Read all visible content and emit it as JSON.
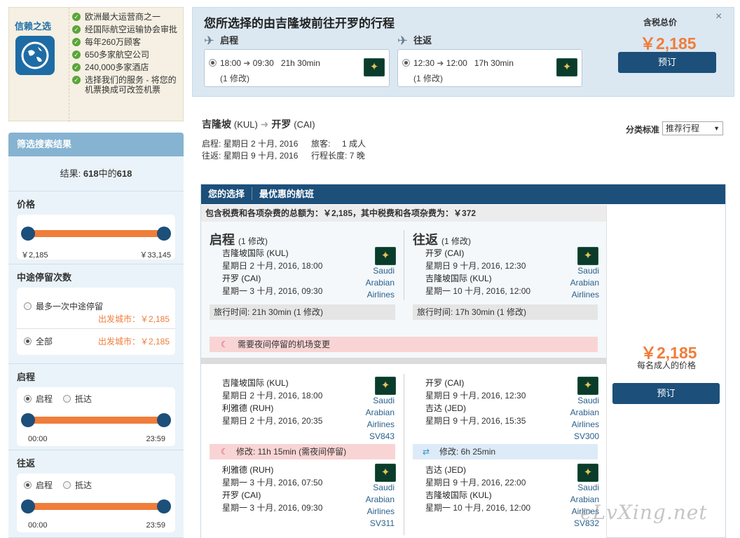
{
  "trust": {
    "title": "信赖之选",
    "items": [
      "欧洲最大运营商之一",
      "经国际航空运输协会审批",
      "每年260万顾客",
      "650多家航空公司",
      "240,000多家酒店",
      "选择我们的服务 - 将您的机票换成可改签机票"
    ]
  },
  "filter": {
    "header": "筛选搜索结果",
    "results_prefix": "结果: ",
    "results_count": "618",
    "results_mid": "中的",
    "results_total": "618",
    "price_title": "价格",
    "price_min": "￥2,185",
    "price_max": "￥33,145",
    "stops_title": "中途停留次数",
    "stop_opt1": "最多一次中途停留",
    "stop_opt1_price": "出发城市：￥2,185",
    "stop_opt2": "全部",
    "stop_opt2_price": "出发城市：￥2,185",
    "outbound_title": "启程",
    "return_title": "往返",
    "depart_label": "启程",
    "arrive_label": "抵达",
    "time_min": "00:00",
    "time_max": "23:59"
  },
  "selected": {
    "title": "您所选择的由吉隆坡前往开罗的行程",
    "out_label": "启程",
    "ret_label": "往返",
    "out_dep": "18:00",
    "out_arr": "09:30",
    "out_dur": "21h 30min",
    "out_stops": "(1 修改)",
    "ret_dep": "12:30",
    "ret_arr": "12:00",
    "ret_dur": "17h 30min",
    "ret_stops": "(1 修改)",
    "price_label": "含税总价",
    "price": "￥2,185",
    "book": "预订",
    "close": "×"
  },
  "route": {
    "from": "吉隆坡",
    "from_code": "(KUL)",
    "to": "开罗",
    "to_code": "(CAI)",
    "out_label": "启程:",
    "out_date": "星期日 2 十月, 2016",
    "ret_label": "往返:",
    "ret_date": "星期日 9 十月, 2016",
    "pax_label": "旅客:",
    "pax": "1 成人",
    "len_label": "行程长度:",
    "len": "7 晚",
    "sort_label": "分类标准",
    "sort_value": "推荐行程"
  },
  "card": {
    "tab1": "您的选择",
    "tab2": "最优惠的航班",
    "tax_note": "包含税费和各项杂费的总额为：￥2,185，其中税费和各项杂费为：￥372",
    "out_name": "启程",
    "out_sub": "(1 修改)",
    "ret_name": "往返",
    "ret_sub": "(1 修改)",
    "out_from": "吉隆坡国际 (KUL)",
    "out_from_time": "星期日 2 十月, 2016, 18:00",
    "out_to": "开罗 (CAI)",
    "out_to_time": "星期一 3 十月, 2016, 09:30",
    "ret_from": "开罗 (CAI)",
    "ret_from_time": "星期日 9 十月, 2016, 12:30",
    "ret_to": "吉隆坡国际 (KUL)",
    "ret_to_time": "星期一 10 十月, 2016, 12:00",
    "airline": [
      "Saudi",
      "Arabian",
      "Airlines"
    ],
    "out_travel": "旅行时间: 21h 30min (1 修改)",
    "ret_travel": "旅行时间: 17h 30min (1 修改)",
    "overnight_warn": "需要夜间停留的机场变更",
    "price": "￥2,185",
    "per_adult": "每名成人的价格",
    "book": "预订",
    "s1_from": "吉隆坡国际 (KUL)",
    "s1_from_time": "星期日 2 十月, 2016, 18:00",
    "s1_to": "利雅德 (RUH)",
    "s1_to_time": "星期日 2 十月, 2016, 20:35",
    "s1_flight": "SV843",
    "s1_layover": "修改: 11h 15min (需夜间停留)",
    "s2_from": "利雅德 (RUH)",
    "s2_from_time": "星期一 3 十月, 2016, 07:50",
    "s2_to": "开罗 (CAI)",
    "s2_to_time": "星期一 3 十月, 2016, 09:30",
    "s2_flight": "SV311",
    "r1_from": "开罗 (CAI)",
    "r1_from_time": "星期日 9 十月, 2016, 12:30",
    "r1_to": "吉达 (JED)",
    "r1_to_time": "星期日 9 十月, 2016, 15:35",
    "r1_flight": "SV300",
    "r1_layover": "修改: 6h 25min",
    "r2_from": "吉达 (JED)",
    "r2_from_time": "星期日 9 十月, 2016, 22:00",
    "r2_to": "吉隆坡国际 (KUL)",
    "r2_to_time": "星期一 10 十月, 2016, 12:00",
    "r2_flight": "SV832"
  },
  "watermark": "eLvXing.net",
  "colors": {
    "accent": "#1c4f7a",
    "price": "#f07d3a",
    "filter_bg": "#bcd5e5"
  }
}
